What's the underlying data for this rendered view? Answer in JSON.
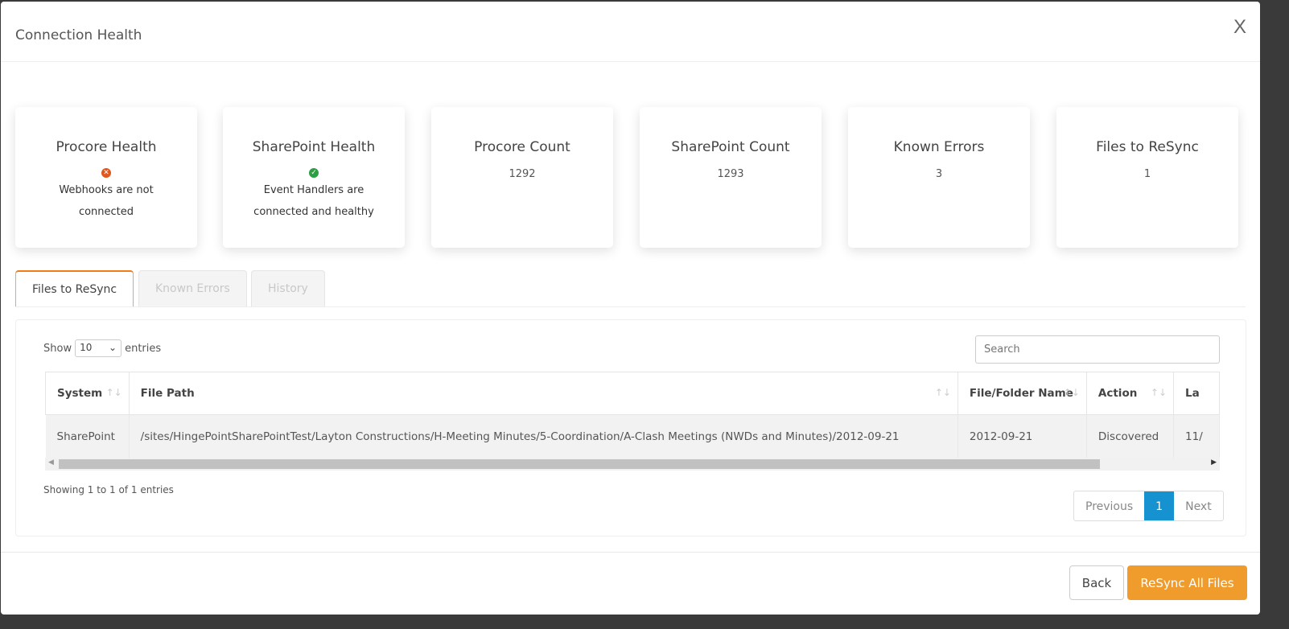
{
  "modal": {
    "title": "Connection Health",
    "close_label": "X"
  },
  "cards": [
    {
      "title": "Procore Health",
      "status": "error",
      "icon": "x-circle-icon",
      "color": "#e0571e",
      "message_lines": [
        "Webhooks are not",
        "connected"
      ]
    },
    {
      "title": "SharePoint Health",
      "status": "ok",
      "icon": "check-circle-icon",
      "color": "#2e9e44",
      "message_lines": [
        "Event Handlers are",
        "connected and healthy"
      ]
    },
    {
      "title": "Procore Count",
      "value": "1292"
    },
    {
      "title": "SharePoint Count",
      "value": "1293"
    },
    {
      "title": "Known Errors",
      "value": "3"
    },
    {
      "title": "Files to ReSync",
      "value": "1"
    }
  ],
  "tabs": [
    {
      "label": "Files to ReSync",
      "active": true
    },
    {
      "label": "Known Errors"
    },
    {
      "label": "History"
    }
  ],
  "table_controls": {
    "show_label": "Show",
    "page_size": "10",
    "entries_label": "entries",
    "search_placeholder": "Search"
  },
  "table": {
    "columns": [
      "System",
      "File Path",
      "File/Folder Name",
      "Action",
      "La"
    ],
    "rows": [
      [
        "SharePoint",
        "/sites/HingePointSharePointTest/Layton Constructions/H-Meeting Minutes/5-Coordination/A-Clash Meetings (NWDs and Minutes)/2012-09-21",
        "2012-09-21",
        "Discovered",
        "11/"
      ]
    ]
  },
  "info": "Showing 1 to 1 of 1 entries",
  "pagination": {
    "previous": "Previous",
    "current": "1",
    "next": "Next"
  },
  "footer": {
    "back": "Back",
    "resync": "ReSync All Files"
  },
  "colors": {
    "accent": "#f09c2c",
    "page_active": "#1592cf",
    "tab_active_border": "#f07d1a"
  }
}
